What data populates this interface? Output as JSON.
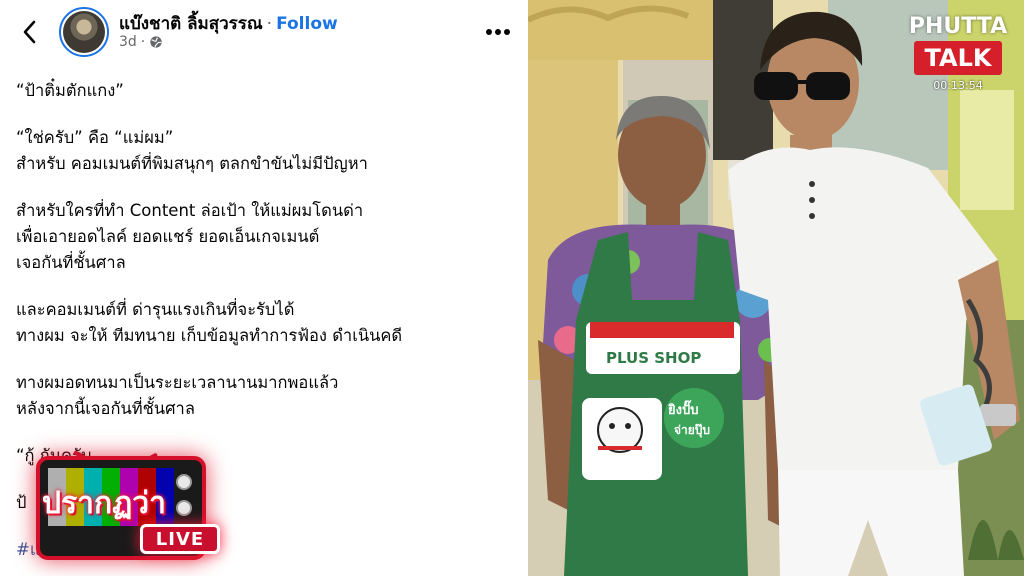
{
  "post": {
    "author": "แบ๊งชาติ ลิ้มสุวรรณ",
    "separator": "·",
    "follow_label": "Follow",
    "time": "3d",
    "body_lines": [
      "“ป้าติ๋มตักแกง”",
      "",
      "“ใช่ครับ” คือ “แม่ผม”",
      "สำหรับ คอมเมนต์ที่พิมสนุกๆ ตลกขำขันไม่มีปัญหา",
      "",
      "สำหรับใครที่ทำ Content ล่อเป้า ให้แม่ผมโดนด่า",
      "เพื่อเอายอดไลค์ ยอดแชร์ ยอดเอ็นเกจเมนต์",
      "เจอกันที่ชั้นศาล",
      "",
      "และคอมเมนต์ที่ ด่ารุนแรงเกินที่จะรับได้",
      "ทางผม จะให้ ทีมทนาย เก็บข้อมูลทำการฟ้อง ดำเนินคดี",
      "",
      "ทางผมอดทนมาเป็นระยะเวลานานมากพอแล้ว",
      "หลังจากนี้เจอกันที่ชั้นศาล",
      "",
      "“กู้                                 กันครับ",
      "",
      "ป้"
    ],
    "hashtag": "#แบ๊งชาติตลาดยันต์"
  },
  "overlay": {
    "title": "ปรากฏว่า",
    "live": "LIVE"
  },
  "photo": {
    "watermark_top": "PHUTTA",
    "watermark_badge": "TALK",
    "timestamp": "00:13:54",
    "apron_brand": "PLUS SHOP",
    "apron_slogan_1": "ยิงปั๊บ",
    "apron_slogan_2": "จ่ายปุ๊บ"
  },
  "colors": {
    "accent": "#1b74e4",
    "live_red": "#c8102e",
    "apron_green": "#2f7a46"
  },
  "icons": [
    "back-arrow-icon",
    "globe-icon",
    "more-icon",
    "tv-logo-icon"
  ]
}
